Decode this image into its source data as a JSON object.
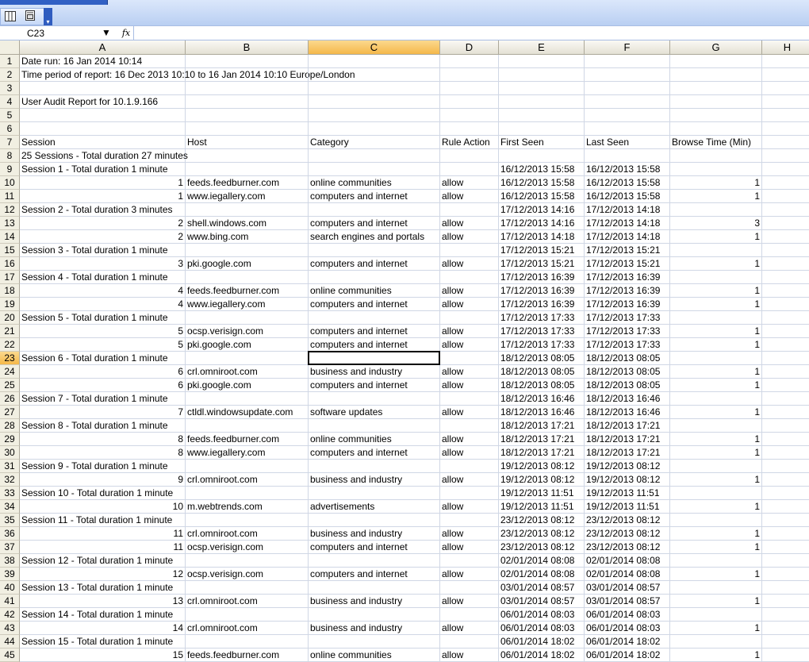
{
  "name_box": {
    "value": "C23"
  },
  "formula_bar": {
    "fx_label": "fx",
    "content": ""
  },
  "toolbar": {
    "icons": [
      "columns-icon",
      "print-preview-icon"
    ]
  },
  "columns": [
    "A",
    "B",
    "C",
    "D",
    "E",
    "F",
    "G",
    "H"
  ],
  "selected_column": "C",
  "selected_row": 23,
  "rows": [
    {
      "n": "1",
      "a": "Date run: 16 Jan 2014 10:14"
    },
    {
      "n": "2",
      "a": "Time period of report: 16 Dec 2013 10:10 to 16 Jan 2014 10:10 Europe/London"
    },
    {
      "n": "3"
    },
    {
      "n": "4",
      "a": "User Audit Report for 10.1.9.166"
    },
    {
      "n": "5"
    },
    {
      "n": "6"
    },
    {
      "n": "7",
      "a": "Session",
      "b": "Host",
      "c": "Category",
      "d": "Rule Action",
      "e": "First Seen",
      "f": "Last Seen",
      "g": "Browse Time (Min)"
    },
    {
      "n": "8",
      "a": "25 Sessions - Total duration 27 minutes"
    },
    {
      "n": "9",
      "a": "Session 1 - Total duration 1 minute",
      "e": "16/12/2013 15:58",
      "f": "16/12/2013 15:58"
    },
    {
      "n": "10",
      "a": "1",
      "b": "feeds.feedburner.com",
      "c": "online communities",
      "d": "allow",
      "e": "16/12/2013 15:58",
      "f": "16/12/2013 15:58",
      "g": "1"
    },
    {
      "n": "11",
      "a": "1",
      "b": "www.iegallery.com",
      "c": "computers and internet",
      "d": "allow",
      "e": "16/12/2013 15:58",
      "f": "16/12/2013 15:58",
      "g": "1"
    },
    {
      "n": "12",
      "a": "Session 2 - Total duration 3 minutes",
      "e": "17/12/2013 14:16",
      "f": "17/12/2013 14:18"
    },
    {
      "n": "13",
      "a": "2",
      "b": "shell.windows.com",
      "c": "computers and internet",
      "d": "allow",
      "e": "17/12/2013 14:16",
      "f": "17/12/2013 14:18",
      "g": "3"
    },
    {
      "n": "14",
      "a": "2",
      "b": "www.bing.com",
      "c": "search engines and portals",
      "d": "allow",
      "e": "17/12/2013 14:18",
      "f": "17/12/2013 14:18",
      "g": "1"
    },
    {
      "n": "15",
      "a": "Session 3 - Total duration 1 minute",
      "e": "17/12/2013 15:21",
      "f": "17/12/2013 15:21"
    },
    {
      "n": "16",
      "a": "3",
      "b": "pki.google.com",
      "c": "computers and internet",
      "d": "allow",
      "e": "17/12/2013 15:21",
      "f": "17/12/2013 15:21",
      "g": "1"
    },
    {
      "n": "17",
      "a": "Session 4 - Total duration 1 minute",
      "e": "17/12/2013 16:39",
      "f": "17/12/2013 16:39"
    },
    {
      "n": "18",
      "a": "4",
      "b": "feeds.feedburner.com",
      "c": "online communities",
      "d": "allow",
      "e": "17/12/2013 16:39",
      "f": "17/12/2013 16:39",
      "g": "1"
    },
    {
      "n": "19",
      "a": "4",
      "b": "www.iegallery.com",
      "c": "computers and internet",
      "d": "allow",
      "e": "17/12/2013 16:39",
      "f": "17/12/2013 16:39",
      "g": "1"
    },
    {
      "n": "20",
      "a": "Session 5 - Total duration 1 minute",
      "e": "17/12/2013 17:33",
      "f": "17/12/2013 17:33"
    },
    {
      "n": "21",
      "a": "5",
      "b": "ocsp.verisign.com",
      "c": "computers and internet",
      "d": "allow",
      "e": "17/12/2013 17:33",
      "f": "17/12/2013 17:33",
      "g": "1"
    },
    {
      "n": "22",
      "a": "5",
      "b": "pki.google.com",
      "c": "computers and internet",
      "d": "allow",
      "e": "17/12/2013 17:33",
      "f": "17/12/2013 17:33",
      "g": "1"
    },
    {
      "n": "23",
      "a": "Session 6 - Total duration 1 minute",
      "e": "18/12/2013 08:05",
      "f": "18/12/2013 08:05"
    },
    {
      "n": "24",
      "a": "6",
      "b": "crl.omniroot.com",
      "c": "business and industry",
      "d": "allow",
      "e": "18/12/2013 08:05",
      "f": "18/12/2013 08:05",
      "g": "1"
    },
    {
      "n": "25",
      "a": "6",
      "b": "pki.google.com",
      "c": "computers and internet",
      "d": "allow",
      "e": "18/12/2013 08:05",
      "f": "18/12/2013 08:05",
      "g": "1"
    },
    {
      "n": "26",
      "a": "Session 7 - Total duration 1 minute",
      "e": "18/12/2013 16:46",
      "f": "18/12/2013 16:46"
    },
    {
      "n": "27",
      "a": "7",
      "b": "ctldl.windowsupdate.com",
      "c": "software updates",
      "d": "allow",
      "e": "18/12/2013 16:46",
      "f": "18/12/2013 16:46",
      "g": "1"
    },
    {
      "n": "28",
      "a": "Session 8 - Total duration 1 minute",
      "e": "18/12/2013 17:21",
      "f": "18/12/2013 17:21"
    },
    {
      "n": "29",
      "a": "8",
      "b": "feeds.feedburner.com",
      "c": "online communities",
      "d": "allow",
      "e": "18/12/2013 17:21",
      "f": "18/12/2013 17:21",
      "g": "1"
    },
    {
      "n": "30",
      "a": "8",
      "b": "www.iegallery.com",
      "c": "computers and internet",
      "d": "allow",
      "e": "18/12/2013 17:21",
      "f": "18/12/2013 17:21",
      "g": "1"
    },
    {
      "n": "31",
      "a": "Session 9 - Total duration 1 minute",
      "e": "19/12/2013 08:12",
      "f": "19/12/2013 08:12"
    },
    {
      "n": "32",
      "a": "9",
      "b": "crl.omniroot.com",
      "c": "business and industry",
      "d": "allow",
      "e": "19/12/2013 08:12",
      "f": "19/12/2013 08:12",
      "g": "1"
    },
    {
      "n": "33",
      "a": "Session 10 - Total duration 1 minute",
      "e": "19/12/2013 11:51",
      "f": "19/12/2013 11:51"
    },
    {
      "n": "34",
      "a": "10",
      "b": "m.webtrends.com",
      "c": "advertisements",
      "d": "allow",
      "e": "19/12/2013 11:51",
      "f": "19/12/2013 11:51",
      "g": "1"
    },
    {
      "n": "35",
      "a": "Session 11 - Total duration 1 minute",
      "e": "23/12/2013 08:12",
      "f": "23/12/2013 08:12"
    },
    {
      "n": "36",
      "a": "11",
      "b": "crl.omniroot.com",
      "c": "business and industry",
      "d": "allow",
      "e": "23/12/2013 08:12",
      "f": "23/12/2013 08:12",
      "g": "1"
    },
    {
      "n": "37",
      "a": "11",
      "b": "ocsp.verisign.com",
      "c": "computers and internet",
      "d": "allow",
      "e": "23/12/2013 08:12",
      "f": "23/12/2013 08:12",
      "g": "1"
    },
    {
      "n": "38",
      "a": "Session 12 - Total duration 1 minute",
      "e": "02/01/2014 08:08",
      "f": "02/01/2014 08:08"
    },
    {
      "n": "39",
      "a": "12",
      "b": "ocsp.verisign.com",
      "c": "computers and internet",
      "d": "allow",
      "e": "02/01/2014 08:08",
      "f": "02/01/2014 08:08",
      "g": "1"
    },
    {
      "n": "40",
      "a": "Session 13 - Total duration 1 minute",
      "e": "03/01/2014 08:57",
      "f": "03/01/2014 08:57"
    },
    {
      "n": "41",
      "a": "13",
      "b": "crl.omniroot.com",
      "c": "business and industry",
      "d": "allow",
      "e": "03/01/2014 08:57",
      "f": "03/01/2014 08:57",
      "g": "1"
    },
    {
      "n": "42",
      "a": "Session 14 - Total duration 1 minute",
      "e": "06/01/2014 08:03",
      "f": "06/01/2014 08:03"
    },
    {
      "n": "43",
      "a": "14",
      "b": "crl.omniroot.com",
      "c": "business and industry",
      "d": "allow",
      "e": "06/01/2014 08:03",
      "f": "06/01/2014 08:03",
      "g": "1"
    },
    {
      "n": "44",
      "a": "Session 15 - Total duration 1 minute",
      "e": "06/01/2014 18:02",
      "f": "06/01/2014 18:02"
    },
    {
      "n": "45",
      "a": "15",
      "b": "feeds.feedburner.com",
      "c": "online communities",
      "d": "allow",
      "e": "06/01/2014 18:02",
      "f": "06/01/2014 18:02",
      "g": "1"
    }
  ]
}
